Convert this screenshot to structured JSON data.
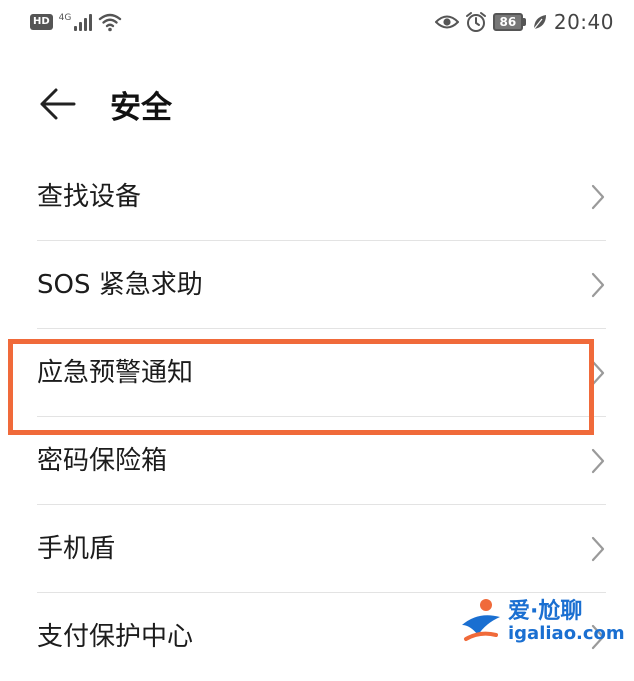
{
  "status_bar": {
    "hd_label": "HD",
    "network_label": "4G",
    "battery_level": "86",
    "time": "20:40",
    "icons": [
      "hd-icon",
      "signal-icon",
      "wifi-icon",
      "eye-icon",
      "alarm-icon",
      "battery-icon",
      "leaf-icon"
    ]
  },
  "header": {
    "title": "安全",
    "back_icon": "arrow-left-icon"
  },
  "settings_list": [
    {
      "label": "查找设备"
    },
    {
      "label": "SOS 紧急求助"
    },
    {
      "label": "应急预警通知",
      "highlighted": true
    },
    {
      "label": "密码保险箱"
    },
    {
      "label": "手机盾"
    },
    {
      "label": "支付保护中心"
    }
  ],
  "watermark": {
    "title": "爱·尬聊",
    "url": "igaliao.com"
  },
  "colors": {
    "highlight": "#f06a3a",
    "watermark": "#1a6fd1",
    "divider": "#e3e3e3"
  }
}
